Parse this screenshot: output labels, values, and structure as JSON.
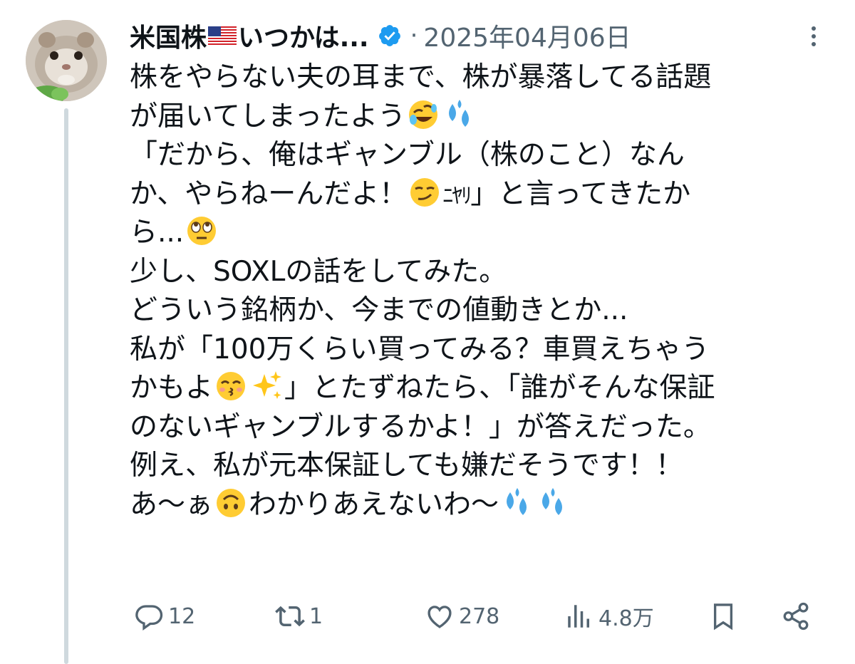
{
  "author": {
    "display_name_prefix": "米国株",
    "display_name_suffix": "いつかは...",
    "verified": true,
    "separator": "·",
    "date": "2025年04月06日"
  },
  "tweet": {
    "lines": [
      "株をやらない夫の耳まで、株が暴落してる話題",
      "が届いてしまったよう",
      "「だから、俺はギャンブル（株のこと）なん",
      "か、やらねーんだよ！",
      "」と言ってきたか",
      "ら...",
      "少し、SOXLの話をしてみた。",
      "どういう銘柄か、今までの値動きとか...",
      "私が「100万くらい買ってみる？車買えちゃう",
      "かもよ",
      "」とたずねたら、「誰がそんな保証",
      "のないギャンブルするかよ！」が答えだった。",
      "例え、私が元本保証しても嫌だそうです！！",
      "あ〜ぁ",
      "わかりあえないわ〜"
    ],
    "nyari_text": "ﾆﾔﾘ"
  },
  "actions": {
    "reply_count": "12",
    "retweet_count": "1",
    "like_count": "278",
    "view_count": "4.8万"
  },
  "colors": {
    "text": "#0f1419",
    "muted": "#536471",
    "verified": "#1d9bf0",
    "thread_line": "#cfd9de"
  }
}
